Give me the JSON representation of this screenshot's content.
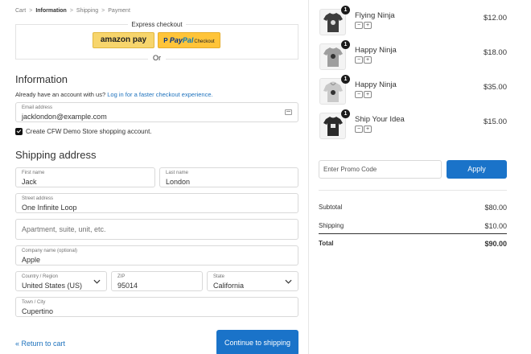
{
  "breadcrumb": {
    "items": [
      "Cart",
      "Information",
      "Shipping",
      "Payment"
    ],
    "separator": ">"
  },
  "express": {
    "title": "Express checkout",
    "amazon_label": "amazon pay",
    "paypal_icon": "P",
    "paypal_brand_1": "Pay",
    "paypal_brand_2": "Pal",
    "paypal_suffix": "Checkout"
  },
  "or_text": "Or",
  "information": {
    "heading": "Information",
    "account_prompt": "Already have an account with us?",
    "login_link": "Log in for a faster checkout experience.",
    "email": {
      "label": "Email address",
      "value": "jacklondon@example.com"
    },
    "create_account": {
      "label": "Create CFW Demo Store shopping account.",
      "checked": true
    }
  },
  "shipping": {
    "heading": "Shipping address",
    "first_name": {
      "label": "First name",
      "value": "Jack"
    },
    "last_name": {
      "label": "Last name",
      "value": "London"
    },
    "street": {
      "label": "Street address",
      "value": "One Infinite Loop"
    },
    "apartment": {
      "placeholder": "Apartment, suite, unit, etc."
    },
    "company": {
      "label": "Company name (optional)",
      "value": "Apple"
    },
    "country": {
      "label": "Country / Region",
      "value": "United States (US)"
    },
    "zip": {
      "label": "ZIP",
      "value": "95014"
    },
    "state": {
      "label": "State",
      "value": "California"
    },
    "town": {
      "label": "Town / City",
      "value": "Cupertino"
    }
  },
  "footer": {
    "return_link": "« Return to cart",
    "continue_button": "Continue to shipping"
  },
  "cart": {
    "items": [
      {
        "name": "Flying Ninja",
        "quantity": "1",
        "price": "$12.00",
        "minus": "−",
        "plus": "+"
      },
      {
        "name": "Happy Ninja",
        "quantity": "1",
        "price": "$18.00",
        "minus": "−",
        "plus": "+"
      },
      {
        "name": "Happy Ninja",
        "quantity": "1",
        "price": "$35.00",
        "minus": "−",
        "plus": "+"
      },
      {
        "name": "Ship Your Idea",
        "quantity": "1",
        "price": "$15.00",
        "minus": "−",
        "plus": "+"
      }
    ],
    "promo_placeholder": "Enter Promo Code",
    "apply_label": "Apply"
  },
  "totals": {
    "subtotal_label": "Subtotal",
    "subtotal_value": "$80.00",
    "shipping_label": "Shipping",
    "shipping_value": "$10.00",
    "total_label": "Total",
    "total_value": "$90.00"
  },
  "colors": {
    "accent": "#1a73c9",
    "link": "#1e72bd",
    "amazon": "#f7d56c",
    "paypal": "#ffc439"
  }
}
